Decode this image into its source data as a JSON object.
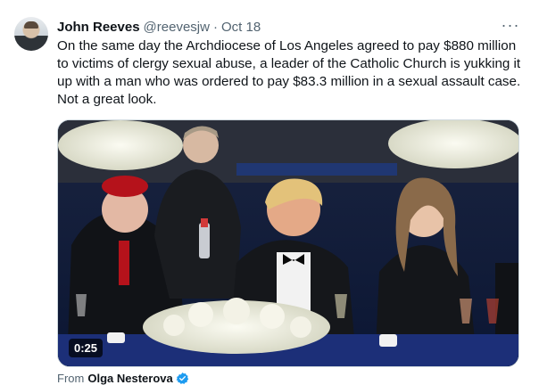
{
  "tweet": {
    "author_name": "John Reeves",
    "author_handle": "@reevesjw",
    "separator": "·",
    "date": "Oct 18",
    "more_icon": "more-horizontal-icon",
    "text": "On the same day the Archdiocese of Los Angeles agreed to pay $880 million to victims of clergy sexual abuse, a leader of the Catholic Church is yukking it up with a man who was ordered to pay $83.3 million in a sexual assault case. Not a great look."
  },
  "media": {
    "video_time": "0:25"
  },
  "attribution": {
    "label": "From",
    "name": "Olga Nesterova",
    "verified_icon": "verified-badge-icon",
    "verified_color": "#1d9bf0"
  }
}
